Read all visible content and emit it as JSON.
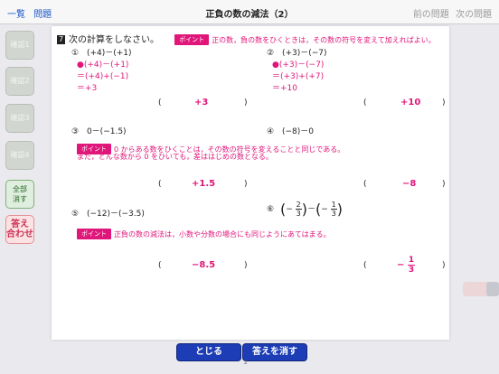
{
  "topbar": {
    "list_link": "一覧",
    "problems_link": "問題",
    "title": "正負の数の減法（2）",
    "prev_label": "前の問題",
    "next_label": "次の問題"
  },
  "sidebar": {
    "items": [
      {
        "label": "確認1"
      },
      {
        "label": "確認2"
      },
      {
        "label": "確認3"
      },
      {
        "label": "確認4"
      }
    ],
    "allclear_line1": "全部",
    "allclear_line2": "消す",
    "answer_line1": "答え",
    "answer_line2": "合わせ"
  },
  "worksheet": {
    "question_number": "7",
    "instruction": "次の計算をしなさい。",
    "point_label": "ポイント",
    "point1_text": "正の数，負の数をひくときは，その数の符号を変えて加えればよい。",
    "point2_text": "0 からある数をひくことは，その数の符号を変えることと同じである。",
    "point2_line2": "また，どんな数から 0 をひいても，差ははじめの数となる。",
    "point3_text": "正負の数の減法は，小数や分数の場合にも同じようにあてはまる。",
    "problems": [
      {
        "num": "①",
        "expr": "(+4)－(+1)",
        "steps": [
          "●(+4)－(+1)",
          "＝(+4)+(−1)",
          "＝+3"
        ],
        "answer": "+3"
      },
      {
        "num": "②",
        "expr": "(+3)－(−7)",
        "steps": [
          "●(+3)－(−7)",
          "＝(+3)+(+7)",
          "＝+10"
        ],
        "answer": "+10"
      },
      {
        "num": "③",
        "expr": "0－(−1.5)",
        "answer": "+1.5"
      },
      {
        "num": "④",
        "expr": "(−8)－0",
        "answer": "−8"
      },
      {
        "num": "⑤",
        "expr": "(−12)－(−3.5)",
        "answer": "−8.5"
      },
      {
        "num": "⑥",
        "expr_left_sign": "−",
        "expr_left_num": "2",
        "expr_left_den": "3",
        "expr_op": "－",
        "expr_right_sign": "−",
        "expr_right_num": "1",
        "expr_right_den": "3",
        "answer_sign": "−",
        "answer_num": "1",
        "answer_den": "3"
      }
    ],
    "open_paren": "(",
    "close_paren": ")"
  },
  "bottom": {
    "close_label": "とじる",
    "clear_label": "答えを消す",
    "page_number": "2"
  },
  "colors": {
    "accent": "#e0167a",
    "button_blue": "#1c3db5",
    "link_blue": "#1a55c9"
  }
}
